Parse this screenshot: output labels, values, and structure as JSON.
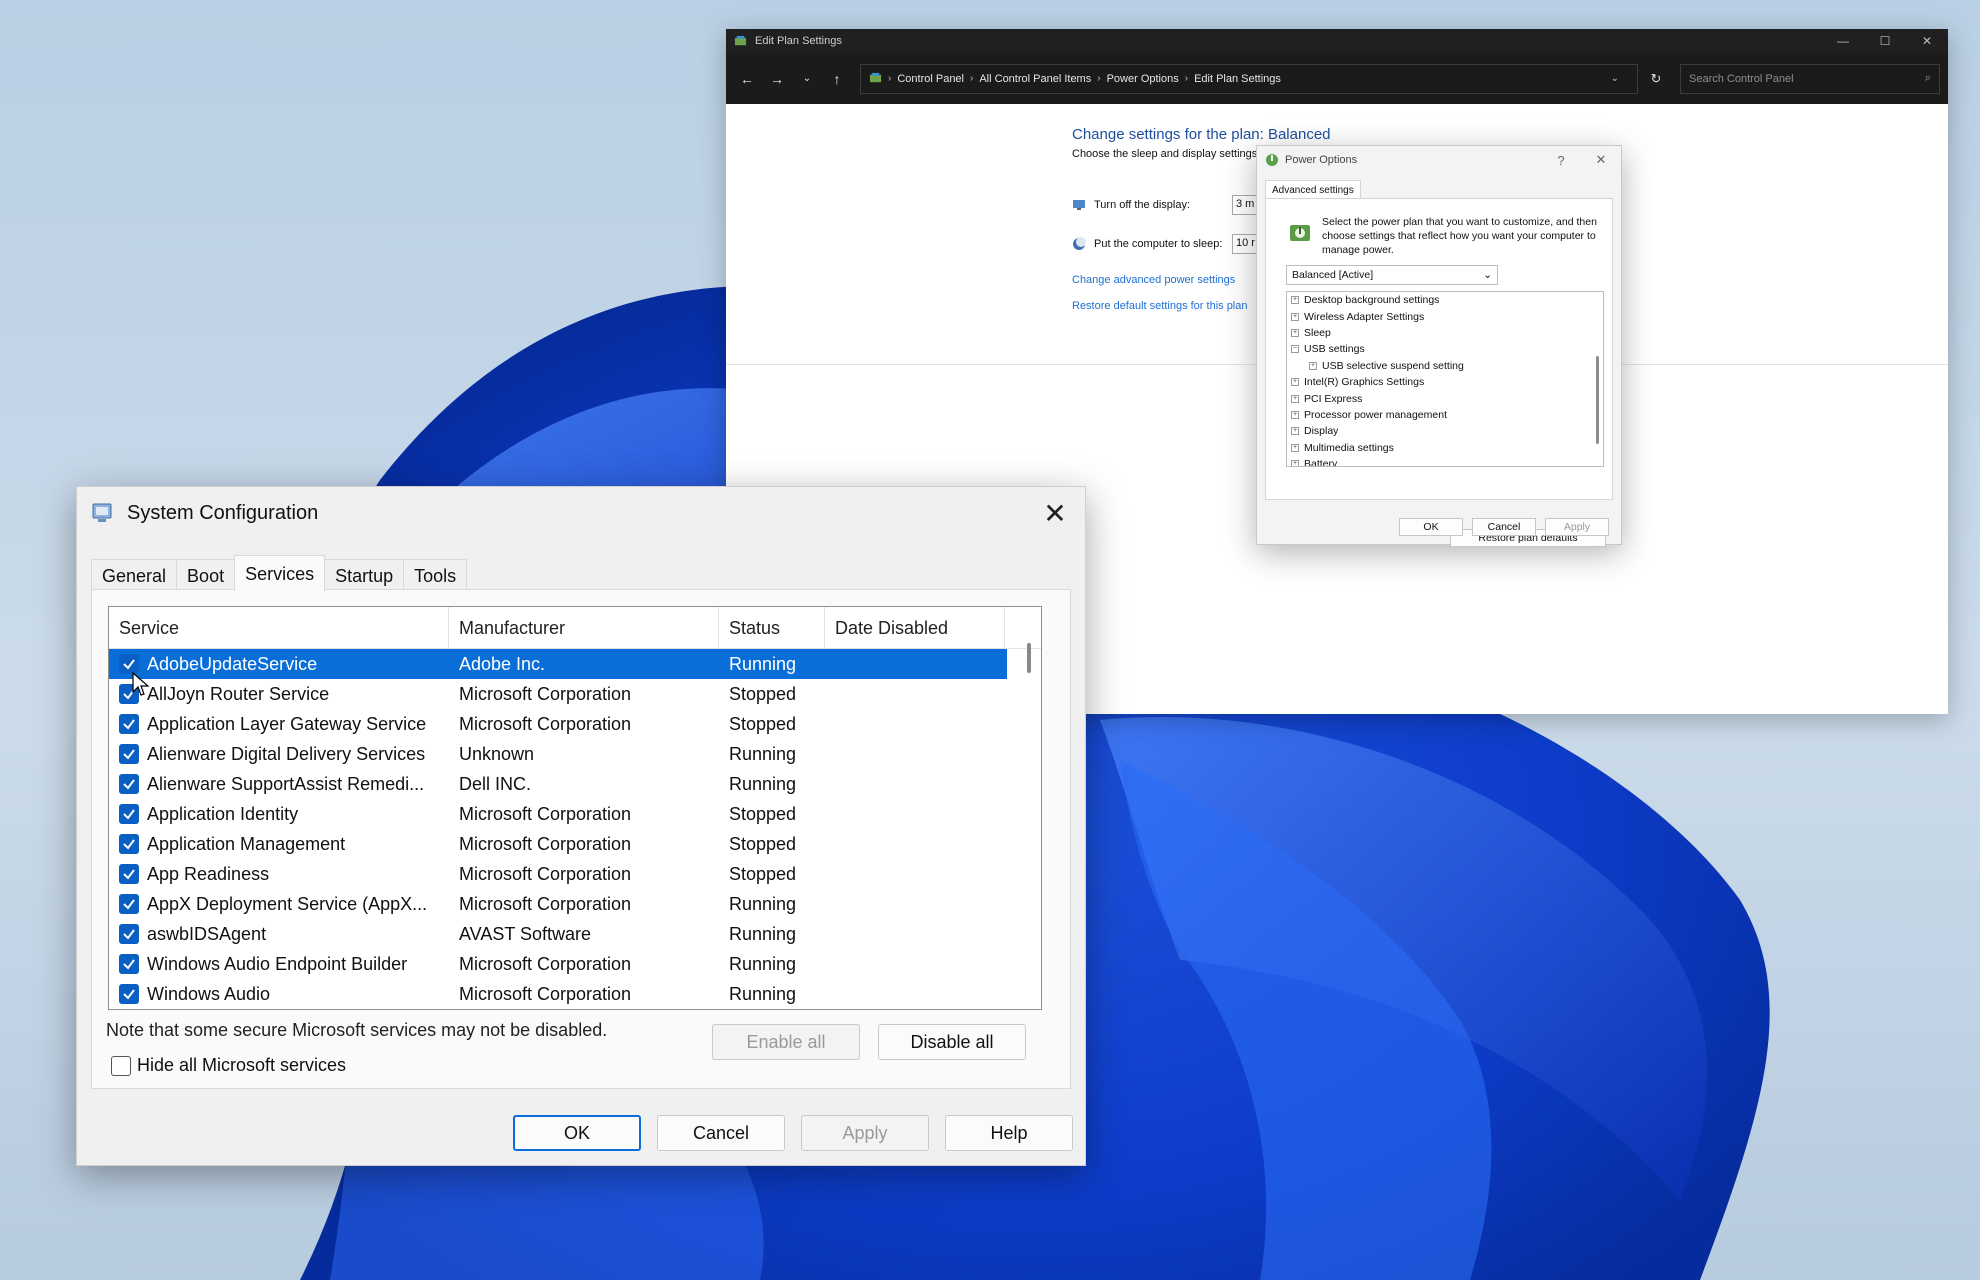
{
  "edit_plan_window": {
    "title": "Edit Plan Settings",
    "breadcrumbs": [
      "Control Panel",
      "All Control Panel Items",
      "Power Options",
      "Edit Plan Settings"
    ],
    "search_placeholder": "Search Control Panel",
    "heading": "Change settings for the plan: Balanced",
    "subheading": "Choose the sleep and display settings",
    "display_label": "Turn off the display:",
    "display_value": "3 m",
    "sleep_label": "Put the computer to sleep:",
    "sleep_value": "10 r",
    "link_advanced": "Change advanced power settings",
    "link_restore": "Restore default settings for this plan"
  },
  "power_options": {
    "title": "Power Options",
    "help": "?",
    "tab": "Advanced settings",
    "description": "Select the power plan that you want to customize, and then choose settings that reflect how you want your computer to manage power.",
    "plan_selected": "Balanced [Active]",
    "tree": [
      {
        "label": "Desktop background settings",
        "sign": "+",
        "level": 0
      },
      {
        "label": "Wireless Adapter Settings",
        "sign": "+",
        "level": 0
      },
      {
        "label": "Sleep",
        "sign": "+",
        "level": 0
      },
      {
        "label": "USB settings",
        "sign": "−",
        "level": 0
      },
      {
        "label": "USB selective suspend setting",
        "sign": "+",
        "level": 1
      },
      {
        "label": "Intel(R) Graphics Settings",
        "sign": "+",
        "level": 0
      },
      {
        "label": "PCI Express",
        "sign": "+",
        "level": 0
      },
      {
        "label": "Processor power management",
        "sign": "+",
        "level": 0
      },
      {
        "label": "Display",
        "sign": "+",
        "level": 0
      },
      {
        "label": "Multimedia settings",
        "sign": "+",
        "level": 0
      },
      {
        "label": "Battery",
        "sign": "+",
        "level": 0
      }
    ],
    "restore_defaults": "Restore plan defaults",
    "ok": "OK",
    "cancel": "Cancel",
    "apply": "Apply"
  },
  "system_config": {
    "title": "System Configuration",
    "tabs": [
      "General",
      "Boot",
      "Services",
      "Startup",
      "Tools"
    ],
    "active_tab": "Services",
    "columns": [
      "Service",
      "Manufacturer",
      "Status",
      "Date Disabled"
    ],
    "rows": [
      {
        "service": "AdobeUpdateService",
        "manufacturer": "Adobe Inc.",
        "status": "Running",
        "date_disabled": ""
      },
      {
        "service": "AllJoyn Router Service",
        "manufacturer": "Microsoft Corporation",
        "status": "Stopped",
        "date_disabled": ""
      },
      {
        "service": "Application Layer Gateway Service",
        "manufacturer": "Microsoft Corporation",
        "status": "Stopped",
        "date_disabled": ""
      },
      {
        "service": "Alienware Digital Delivery Services",
        "manufacturer": "Unknown",
        "status": "Running",
        "date_disabled": ""
      },
      {
        "service": "Alienware SupportAssist Remedi...",
        "manufacturer": "Dell INC.",
        "status": "Running",
        "date_disabled": ""
      },
      {
        "service": "Application Identity",
        "manufacturer": "Microsoft Corporation",
        "status": "Stopped",
        "date_disabled": ""
      },
      {
        "service": "Application Management",
        "manufacturer": "Microsoft Corporation",
        "status": "Stopped",
        "date_disabled": ""
      },
      {
        "service": "App Readiness",
        "manufacturer": "Microsoft Corporation",
        "status": "Stopped",
        "date_disabled": ""
      },
      {
        "service": "AppX Deployment Service (AppX...",
        "manufacturer": "Microsoft Corporation",
        "status": "Running",
        "date_disabled": ""
      },
      {
        "service": "aswbIDSAgent",
        "manufacturer": "AVAST Software",
        "status": "Running",
        "date_disabled": ""
      },
      {
        "service": "Windows Audio Endpoint Builder",
        "manufacturer": "Microsoft Corporation",
        "status": "Running",
        "date_disabled": ""
      },
      {
        "service": "Windows Audio",
        "manufacturer": "Microsoft Corporation",
        "status": "Running",
        "date_disabled": ""
      }
    ],
    "note": "Note that some secure Microsoft services may not be disabled.",
    "enable_all": "Enable all",
    "disable_all": "Disable all",
    "hide_ms": "Hide all Microsoft services",
    "ok": "OK",
    "cancel": "Cancel",
    "apply": "Apply",
    "help": "Help"
  }
}
